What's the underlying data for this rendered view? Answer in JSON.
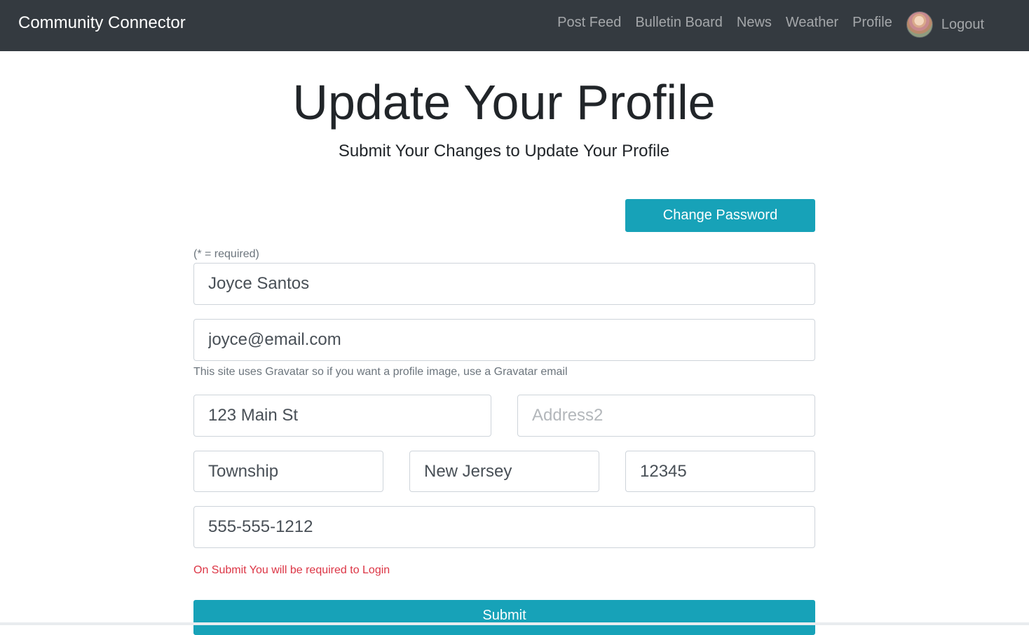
{
  "navbar": {
    "brand": "Community Connector",
    "links": [
      "Post Feed",
      "Bulletin Board",
      "News",
      "Weather",
      "Profile"
    ],
    "logout": "Logout"
  },
  "header": {
    "title": "Update Your Profile",
    "subtitle": "Submit Your Changes to Update Your Profile"
  },
  "actions": {
    "change_password": "Change Password",
    "submit": "Submit"
  },
  "form": {
    "required_note": "(* = required)",
    "name": "Joyce Santos",
    "email": "joyce@email.com",
    "email_help": "This site uses Gravatar so if you want a profile image, use a Gravatar email",
    "address1": "123 Main St",
    "address2": "",
    "address2_placeholder": "Address2",
    "city": "Township",
    "state": "New Jersey",
    "zip": "12345",
    "phone": "555-555-1212",
    "login_warning": "On Submit You will be required to Login"
  },
  "colors": {
    "navbar": "#343a40",
    "accent": "#17a2b8",
    "danger": "#dc3545"
  }
}
